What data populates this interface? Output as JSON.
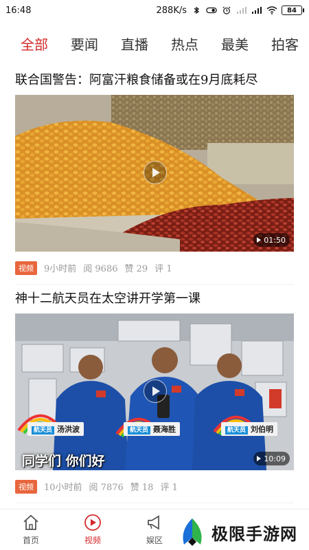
{
  "status_bar": {
    "time": "16:48",
    "network_speed": "288K/s",
    "battery": "84",
    "icons": [
      "bluetooth-icon",
      "toggle-icon",
      "alarm-icon",
      "signal-icon",
      "signal-icon",
      "wifi-icon",
      "battery-icon"
    ]
  },
  "tabs": [
    {
      "label": "全部",
      "active": true
    },
    {
      "label": "要闻",
      "active": false
    },
    {
      "label": "直播",
      "active": false
    },
    {
      "label": "热点",
      "active": false
    },
    {
      "label": "最美",
      "active": false
    },
    {
      "label": "拍客",
      "active": false
    }
  ],
  "feed": [
    {
      "title": "联合国警告：阿富汗粮食储备或在9月底耗尽",
      "duration": "01:50",
      "badge": "视频",
      "time_ago": "9小时前",
      "reads": "阅 9686",
      "likes": "赞 29",
      "comments": "评 1"
    },
    {
      "title": "神十二航天员在太空讲开学第一课",
      "duration": "10:09",
      "badge": "视频",
      "time_ago": "10小时前",
      "reads": "阅 7876",
      "likes": "赞 18",
      "comments": "评 1",
      "overlay": {
        "subtitle": "同学们 你们好",
        "role_tag": "航天员",
        "names": [
          "汤洪波",
          "聂海胜",
          "刘伯明"
        ]
      }
    }
  ],
  "bottom_nav": [
    {
      "label": "首页",
      "icon": "home-icon",
      "active": false
    },
    {
      "label": "视频",
      "icon": "play-circle-icon",
      "active": true
    },
    {
      "label": "娱区",
      "icon": "megaphone-icon",
      "active": false
    }
  ],
  "watermark": {
    "text": "极限手游网"
  },
  "colors": {
    "accent": "#d4282a",
    "badge": "#e8663d",
    "space_suit": "#1d4fa8"
  }
}
